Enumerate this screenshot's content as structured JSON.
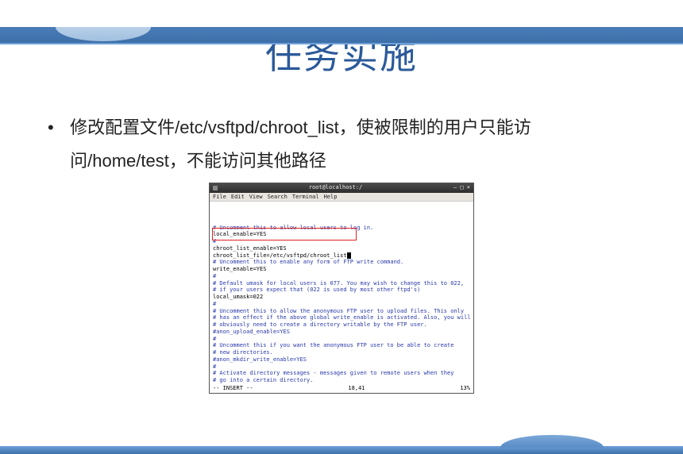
{
  "slide": {
    "title": "任务实施",
    "bullet_text": "修改配置文件/etc/vsftpd/chroot_list，使被限制的用户只能访问/home/test，不能访问其他路径"
  },
  "terminal": {
    "title": "root@localhost:/",
    "menu": [
      "File",
      "Edit",
      "View",
      "Search",
      "Terminal",
      "Help"
    ],
    "lines": [
      {
        "t": "# Uncomment this to allow local users to log in.",
        "c": "blue"
      },
      {
        "t": "local_enable=YES",
        "c": "black"
      },
      {
        "t": "#",
        "c": "blue"
      },
      {
        "t": "chroot_list_enable=YES",
        "c": "black"
      },
      {
        "t": "chroot_list_file=/etc/vsftpd/chroot_list",
        "c": "black",
        "cursor": true
      },
      {
        "t": "# Uncomment this to enable any form of FTP write command.",
        "c": "blue"
      },
      {
        "t": "write_enable=YES",
        "c": "black"
      },
      {
        "t": "#",
        "c": "blue"
      },
      {
        "t": "# Default umask for local users is 077. You may wish to change this to 022,",
        "c": "blue"
      },
      {
        "t": "# if your users expect that (022 is used by most other ftpd's)",
        "c": "blue"
      },
      {
        "t": "local_umask=022",
        "c": "black"
      },
      {
        "t": "#",
        "c": "blue"
      },
      {
        "t": "# Uncomment this to allow the anonymous FTP user to upload files. This only",
        "c": "blue"
      },
      {
        "t": "# has an effect if the above global write_enable is activated. Also, you will",
        "c": "blue"
      },
      {
        "t": "# obviously need to create a directory writable by the FTP user.",
        "c": "blue"
      },
      {
        "t": "#anon_upload_enable=YES",
        "c": "blue"
      },
      {
        "t": "#",
        "c": "blue"
      },
      {
        "t": "# Uncomment this if you want the anonymous FTP user to be able to create",
        "c": "blue"
      },
      {
        "t": "# new directories.",
        "c": "blue"
      },
      {
        "t": "#anon_mkdir_write_enable=YES",
        "c": "blue"
      },
      {
        "t": "#",
        "c": "blue"
      },
      {
        "t": "# Activate directory messages - messages given to remote users when they",
        "c": "blue"
      },
      {
        "t": "# go into a certain directory.",
        "c": "blue"
      }
    ],
    "status_left": "-- INSERT --",
    "status_mid": "18,41",
    "status_right": "13%"
  }
}
